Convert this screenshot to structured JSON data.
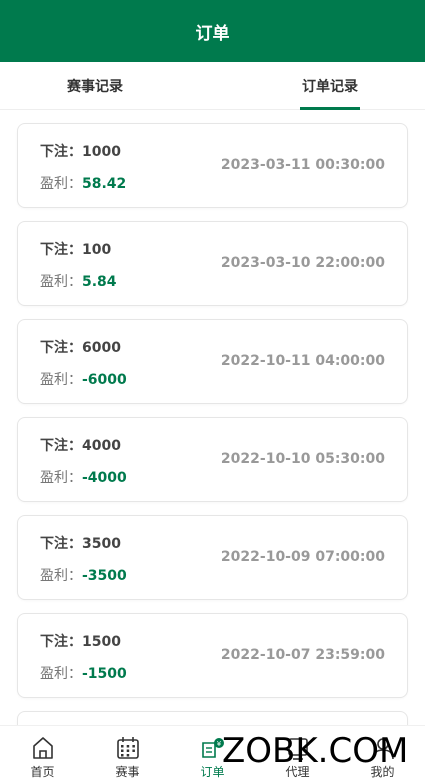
{
  "header": {
    "title": "订单"
  },
  "tabs": [
    {
      "label": "赛事记录",
      "active": false
    },
    {
      "label": "订单记录",
      "active": true
    }
  ],
  "orders": [
    {
      "bet_label": "下注：",
      "bet": "1000",
      "profit_label": "盈利：",
      "profit": "58.42",
      "time": "2023-03-11 00:30:00"
    },
    {
      "bet_label": "下注：",
      "bet": "100",
      "profit_label": "盈利：",
      "profit": "5.84",
      "time": "2023-03-10 22:00:00"
    },
    {
      "bet_label": "下注：",
      "bet": "6000",
      "profit_label": "盈利：",
      "profit": "-6000",
      "time": "2022-10-11 04:00:00"
    },
    {
      "bet_label": "下注：",
      "bet": "4000",
      "profit_label": "盈利：",
      "profit": "-4000",
      "time": "2022-10-10 05:30:00"
    },
    {
      "bet_label": "下注：",
      "bet": "3500",
      "profit_label": "盈利：",
      "profit": "-3500",
      "time": "2022-10-09 07:00:00"
    },
    {
      "bet_label": "下注：",
      "bet": "1500",
      "profit_label": "盈利：",
      "profit": "-1500",
      "time": "2022-10-07 23:59:00"
    }
  ],
  "nav": [
    {
      "label": "首页",
      "icon": "home-icon",
      "active": false
    },
    {
      "label": "赛事",
      "icon": "calendar-icon",
      "active": false
    },
    {
      "label": "订单",
      "icon": "order-icon",
      "active": true
    },
    {
      "label": "代理",
      "icon": "agent-icon",
      "active": false
    },
    {
      "label": "我的",
      "icon": "user-icon",
      "active": false
    }
  ],
  "watermark": "ZOBK.COM",
  "colors": {
    "brand": "#007a4d",
    "muted": "#999999"
  }
}
